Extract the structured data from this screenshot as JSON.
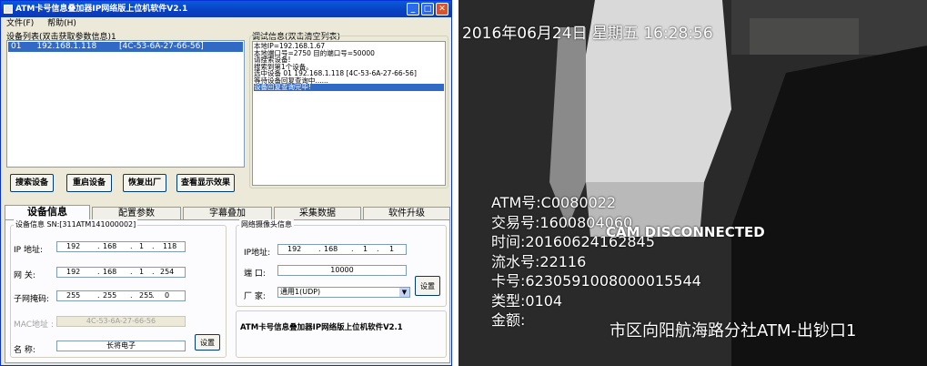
{
  "window": {
    "title": "ATM卡号信息叠加器IP网络版上位机软件V2.1",
    "controls": [
      "_",
      "□",
      "✕"
    ]
  },
  "menu": [
    "文件(F)",
    "帮助(H)"
  ],
  "device_list": {
    "label": "设备列表(双击获取参数信息)1",
    "items": [
      {
        "index": "01",
        "ip": "192.168.1.118",
        "mac": "[4C-53-6A-27-66-56]"
      }
    ]
  },
  "debug": {
    "label": "调试信息(双击清空列表)",
    "lines": [
      "本地IP=192.168.1.67",
      "本地端口号=2750 目的端口号=50000",
      "请搜索设备!",
      "搜索到第1个设备。",
      "选中设备 01 192.168.1.118  [4C-53-6A-27-66-56]",
      "等待设备回复查询中......"
    ],
    "selected_line": "设备回复查询完毕!"
  },
  "action_buttons": [
    "搜索设备",
    "重启设备",
    "恢复出厂",
    "查看显示效果"
  ],
  "tabs": [
    "设备信息",
    "配置参数",
    "字幕叠加",
    "采集数据",
    "软件升级"
  ],
  "device_info": {
    "group_label": "设备信息 SN:[311ATM141000002]",
    "ip_label": "IP 地址:",
    "ip": [
      "192",
      "168",
      "1",
      "118"
    ],
    "gateway_label": "网  关:",
    "gateway": [
      "192",
      "168",
      "1",
      "254"
    ],
    "mask_label": "子网掩码:",
    "mask": [
      "255",
      "255",
      "255",
      "0"
    ],
    "mac_label": "MAC地址 :",
    "mac": "4C-53-6A-27-66-56",
    "name_label": "名  称:",
    "name": "长将电子",
    "set_button": "设置"
  },
  "camera_info": {
    "group_label": "网络摄像头信息",
    "ip_label": "IP地址:",
    "ip": [
      "192",
      "168",
      "1",
      "1"
    ],
    "port_label": "端  口:",
    "port": "10000",
    "vendor_label": "厂  家:",
    "vendor": "通用1(UDP)",
    "set_button": "设置"
  },
  "footer_text": "ATM卡号信息叠加器IP网络版上位机软件V2.1",
  "camera_overlay": {
    "datetime": "2016年06月24日  星期五  16:28:56",
    "disconnected": "CAM DISCONNECTED",
    "lines": [
      "ATM号:C0080022",
      "交易号:1600804060",
      "时间:20160624162845",
      "流水号:22116",
      "卡号:6230591008000015544",
      "类型:0104",
      "金额:"
    ],
    "location": "市区向阳航海路分社ATM-出钞口1"
  },
  "colors": {
    "accent": "#316ac5",
    "titlebar": "#0a4ed0",
    "window_bg": "#ece9d8"
  }
}
